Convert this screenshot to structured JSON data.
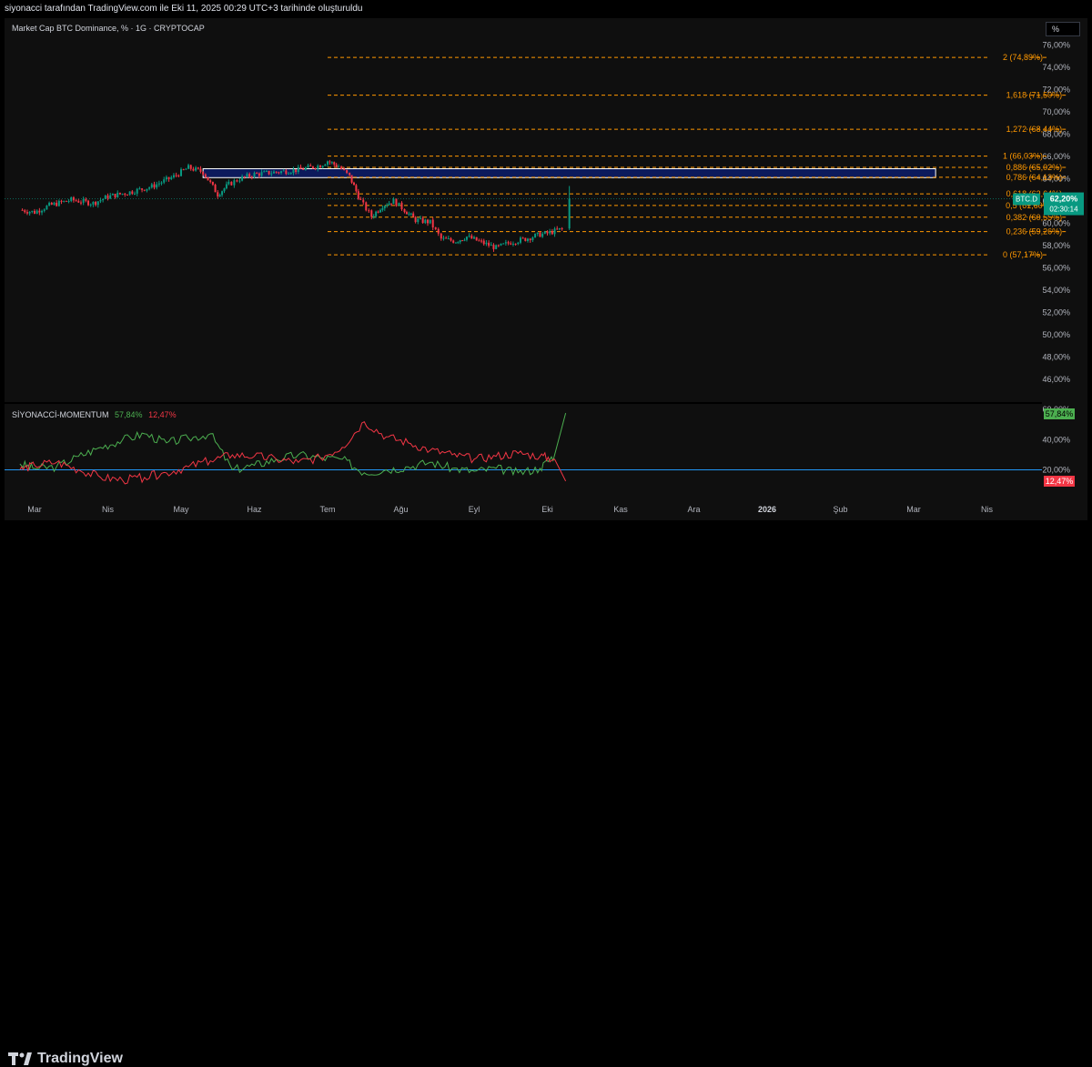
{
  "header": {
    "attribution": "siyonacci tarafından TradingView.com ile Eki 11, 2025 00:29 UTC+3 tarihinde oluşturuldu"
  },
  "main": {
    "symbol_title": "Market Cap BTC Dominance, % · 1G · CRYPTOCAP",
    "scale_button": "%",
    "price_tag": {
      "symbol": "BTC.D",
      "value": "62,20%",
      "countdown": "02:30:14",
      "color": "#089981"
    },
    "supply_zone": {
      "low": 64.1,
      "high": 64.9,
      "fill": "#0c1a5c"
    }
  },
  "indicator": {
    "title": "SİYONACCİ-MOMENTUM",
    "value_green": "57,84%",
    "value_red": "12,47%",
    "tick_labels": [
      "40,00%",
      "20,00%"
    ],
    "top_partial_label": "60,00%",
    "baseline": 20,
    "baseline_color": "#2196f3"
  },
  "footer": {
    "brand": "TradingView"
  },
  "chart_data": [
    {
      "type": "candlestick",
      "title": "Market Cap BTC Dominance, % · 1G · CRYPTOCAP",
      "ylim": [
        44,
        77
      ],
      "y_ticks": [
        "76,00%",
        "74,00%",
        "72,00%",
        "70,00%",
        "68,00%",
        "66,00%",
        "64,00%",
        "62,00%",
        "60,00%",
        "58,00%",
        "56,00%",
        "54,00%",
        "52,00%",
        "50,00%",
        "48,00%",
        "46,00%"
      ],
      "y_tick_values": [
        76,
        74,
        72,
        70,
        68,
        66,
        64,
        62,
        60,
        58,
        56,
        54,
        52,
        50,
        48,
        46
      ],
      "x_ticks": [
        "Mar",
        "Nis",
        "May",
        "Haz",
        "Tem",
        "Ağu",
        "Eyl",
        "Eki",
        "Kas",
        "Ara",
        "2026",
        "Şub",
        "Mar",
        "Nis"
      ],
      "x_tick_months": [
        2,
        3,
        4,
        5,
        6,
        7,
        8,
        9,
        10,
        11,
        12,
        13,
        14,
        15
      ],
      "close_series": {
        "start": "2025-02-25",
        "x_months": [
          1.8,
          2.0,
          2.2,
          2.5,
          2.8,
          3.0,
          3.3,
          3.6,
          3.9,
          4.1,
          4.3,
          4.5,
          4.65,
          4.8,
          5.0,
          5.3,
          5.6,
          5.9,
          6.0,
          6.15,
          6.3,
          6.45,
          6.6,
          6.75,
          6.9,
          7.05,
          7.2,
          7.4,
          7.55,
          7.75,
          7.9,
          8.1,
          8.3,
          8.5,
          8.7,
          8.9,
          9.0,
          9.2,
          9.3
        ],
        "close": [
          61.2,
          61.0,
          61.6,
          62.1,
          61.8,
          62.4,
          62.8,
          63.3,
          64.2,
          65.0,
          64.6,
          62.6,
          63.5,
          64.0,
          64.4,
          64.6,
          64.8,
          65.2,
          65.6,
          65.1,
          64.2,
          62.0,
          60.6,
          61.6,
          62.0,
          61.2,
          60.3,
          60.1,
          58.6,
          58.4,
          58.8,
          58.3,
          57.8,
          58.3,
          58.6,
          59.0,
          59.1,
          59.5,
          62.2
        ]
      },
      "last_price": 62.2,
      "fib_levels": [
        {
          "label": "2 (74,89%)",
          "value": 74.89
        },
        {
          "label": "1,618 (71,50%)",
          "value": 71.5
        },
        {
          "label": "1,272 (68,44%)",
          "value": 68.44
        },
        {
          "label": "1 (66,03%)",
          "value": 66.03
        },
        {
          "label": "0,886 (65,02%)",
          "value": 65.02
        },
        {
          "label": "0,786 (64,13%)",
          "value": 64.13
        },
        {
          "label": "0,618 (62,64%)",
          "value": 62.64
        },
        {
          "label": "0,5 (61,60%)",
          "value": 61.6
        },
        {
          "label": "0,382 (60,55%)",
          "value": 60.55
        },
        {
          "label": "0,236 (59,26%)",
          "value": 59.26
        },
        {
          "label": "0 (57,17%)",
          "value": 57.17
        }
      ],
      "fib_color": "#ff9800",
      "up_color": "#089981",
      "down_color": "#f23645"
    },
    {
      "type": "line",
      "title": "SİYONACCİ-MOMENTUM",
      "ylim": [
        8,
        61
      ],
      "x_months": [
        1.8,
        2.0,
        2.3,
        2.6,
        2.9,
        3.2,
        3.5,
        3.8,
        4.1,
        4.4,
        4.7,
        5.0,
        5.3,
        5.6,
        5.9,
        6.2,
        6.5,
        6.8,
        7.1,
        7.4,
        7.7,
        8.0,
        8.3,
        8.6,
        8.9,
        9.1,
        9.25
      ],
      "series": [
        {
          "color": "#4caf50",
          "values": [
            24,
            21,
            22,
            29,
            35,
            40,
            44,
            38,
            41,
            44,
            20,
            23,
            27,
            30,
            28,
            27,
            18,
            20,
            22,
            25,
            21,
            19,
            21,
            18,
            21,
            30,
            57.84
          ]
        },
        {
          "color": "#f23645",
          "values": [
            20,
            23,
            25,
            20,
            15,
            13,
            15,
            18,
            22,
            26,
            30,
            29,
            27,
            25,
            28,
            35,
            52,
            42,
            38,
            33,
            30,
            27,
            29,
            31,
            29,
            27,
            12.47
          ]
        }
      ]
    }
  ]
}
